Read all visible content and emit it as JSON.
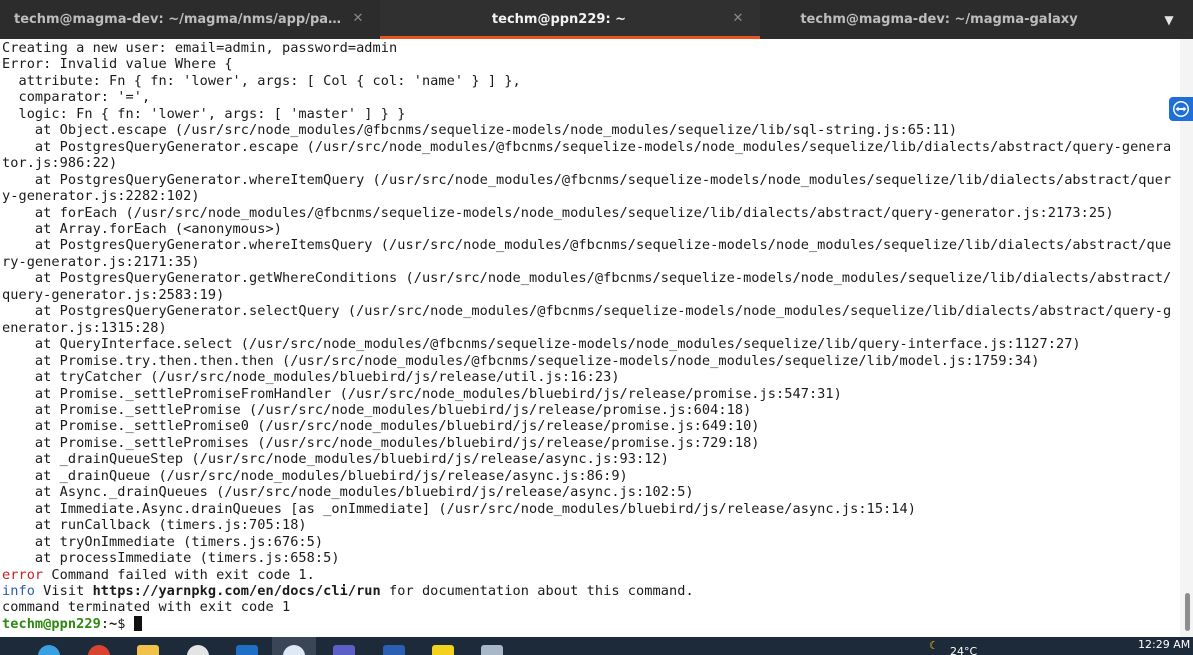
{
  "tabs": [
    {
      "title": "techm@magma-dev: ~/magma/nms/app/packag...",
      "active": false
    },
    {
      "title": "techm@ppn229: ~",
      "active": true
    },
    {
      "title": "techm@magma-dev: ~/magma-galaxy",
      "active": false
    }
  ],
  "icons": {
    "tab_close": "✕",
    "tab_menu": "▼"
  },
  "colors": {
    "accent": "#e95420",
    "error": "#cc1f1f",
    "info": "#2a5db0",
    "prompt": "#2e8a0f"
  },
  "terminal": {
    "lines": [
      "Creating a new user: email=admin, password=admin",
      "Error: Invalid value Where {",
      "  attribute: Fn { fn: 'lower', args: [ Col { col: 'name' } ] },",
      "  comparator: '=',",
      "  logic: Fn { fn: 'lower', args: [ 'master' ] } }",
      "    at Object.escape (/usr/src/node_modules/@fbcnms/sequelize-models/node_modules/sequelize/lib/sql-string.js:65:11)",
      "    at PostgresQueryGenerator.escape (/usr/src/node_modules/@fbcnms/sequelize-models/node_modules/sequelize/lib/dialects/abstract/query-genera",
      "tor.js:986:22)",
      "    at PostgresQueryGenerator.whereItemQuery (/usr/src/node_modules/@fbcnms/sequelize-models/node_modules/sequelize/lib/dialects/abstract/quer",
      "y-generator.js:2282:102)",
      "    at forEach (/usr/src/node_modules/@fbcnms/sequelize-models/node_modules/sequelize/lib/dialects/abstract/query-generator.js:2173:25)",
      "    at Array.forEach (<anonymous>)",
      "    at PostgresQueryGenerator.whereItemsQuery (/usr/src/node_modules/@fbcnms/sequelize-models/node_modules/sequelize/lib/dialects/abstract/que",
      "ry-generator.js:2171:35)",
      "    at PostgresQueryGenerator.getWhereConditions (/usr/src/node_modules/@fbcnms/sequelize-models/node_modules/sequelize/lib/dialects/abstract/",
      "query-generator.js:2583:19)",
      "    at PostgresQueryGenerator.selectQuery (/usr/src/node_modules/@fbcnms/sequelize-models/node_modules/sequelize/lib/dialects/abstract/query-g",
      "enerator.js:1315:28)",
      "    at QueryInterface.select (/usr/src/node_modules/@fbcnms/sequelize-models/node_modules/sequelize/lib/query-interface.js:1127:27)",
      "    at Promise.try.then.then.then (/usr/src/node_modules/@fbcnms/sequelize-models/node_modules/sequelize/lib/model.js:1759:34)",
      "    at tryCatcher (/usr/src/node_modules/bluebird/js/release/util.js:16:23)",
      "    at Promise._settlePromiseFromHandler (/usr/src/node_modules/bluebird/js/release/promise.js:547:31)",
      "    at Promise._settlePromise (/usr/src/node_modules/bluebird/js/release/promise.js:604:18)",
      "    at Promise._settlePromise0 (/usr/src/node_modules/bluebird/js/release/promise.js:649:10)",
      "    at Promise._settlePromises (/usr/src/node_modules/bluebird/js/release/promise.js:729:18)",
      "    at _drainQueueStep (/usr/src/node_modules/bluebird/js/release/async.js:93:12)",
      "    at _drainQueue (/usr/src/node_modules/bluebird/js/release/async.js:86:9)",
      "    at Async._drainQueues (/usr/src/node_modules/bluebird/js/release/async.js:102:5)",
      "    at Immediate.Async.drainQueues [as _onImmediate] (/usr/src/node_modules/bluebird/js/release/async.js:15:14)",
      "    at runCallback (timers.js:705:18)",
      "    at tryOnImmediate (timers.js:676:5)",
      "    at processImmediate (timers.js:658:5)"
    ],
    "error_line": {
      "tag": "error",
      "text": " Command failed with exit code 1."
    },
    "info_line": {
      "tag": "info",
      "prefix": " Visit ",
      "url": "https://yarnpkg.com/en/docs/cli/run",
      "suffix": " for documentation about this command."
    },
    "terminated_line": "command terminated with exit code 1",
    "prompt": {
      "user_host": "techm@ppn229",
      "sep": ":",
      "path": "~",
      "symbol": "$ "
    }
  },
  "taskbar": {
    "tray_text": "24°C",
    "clock": "12:29 AM"
  }
}
